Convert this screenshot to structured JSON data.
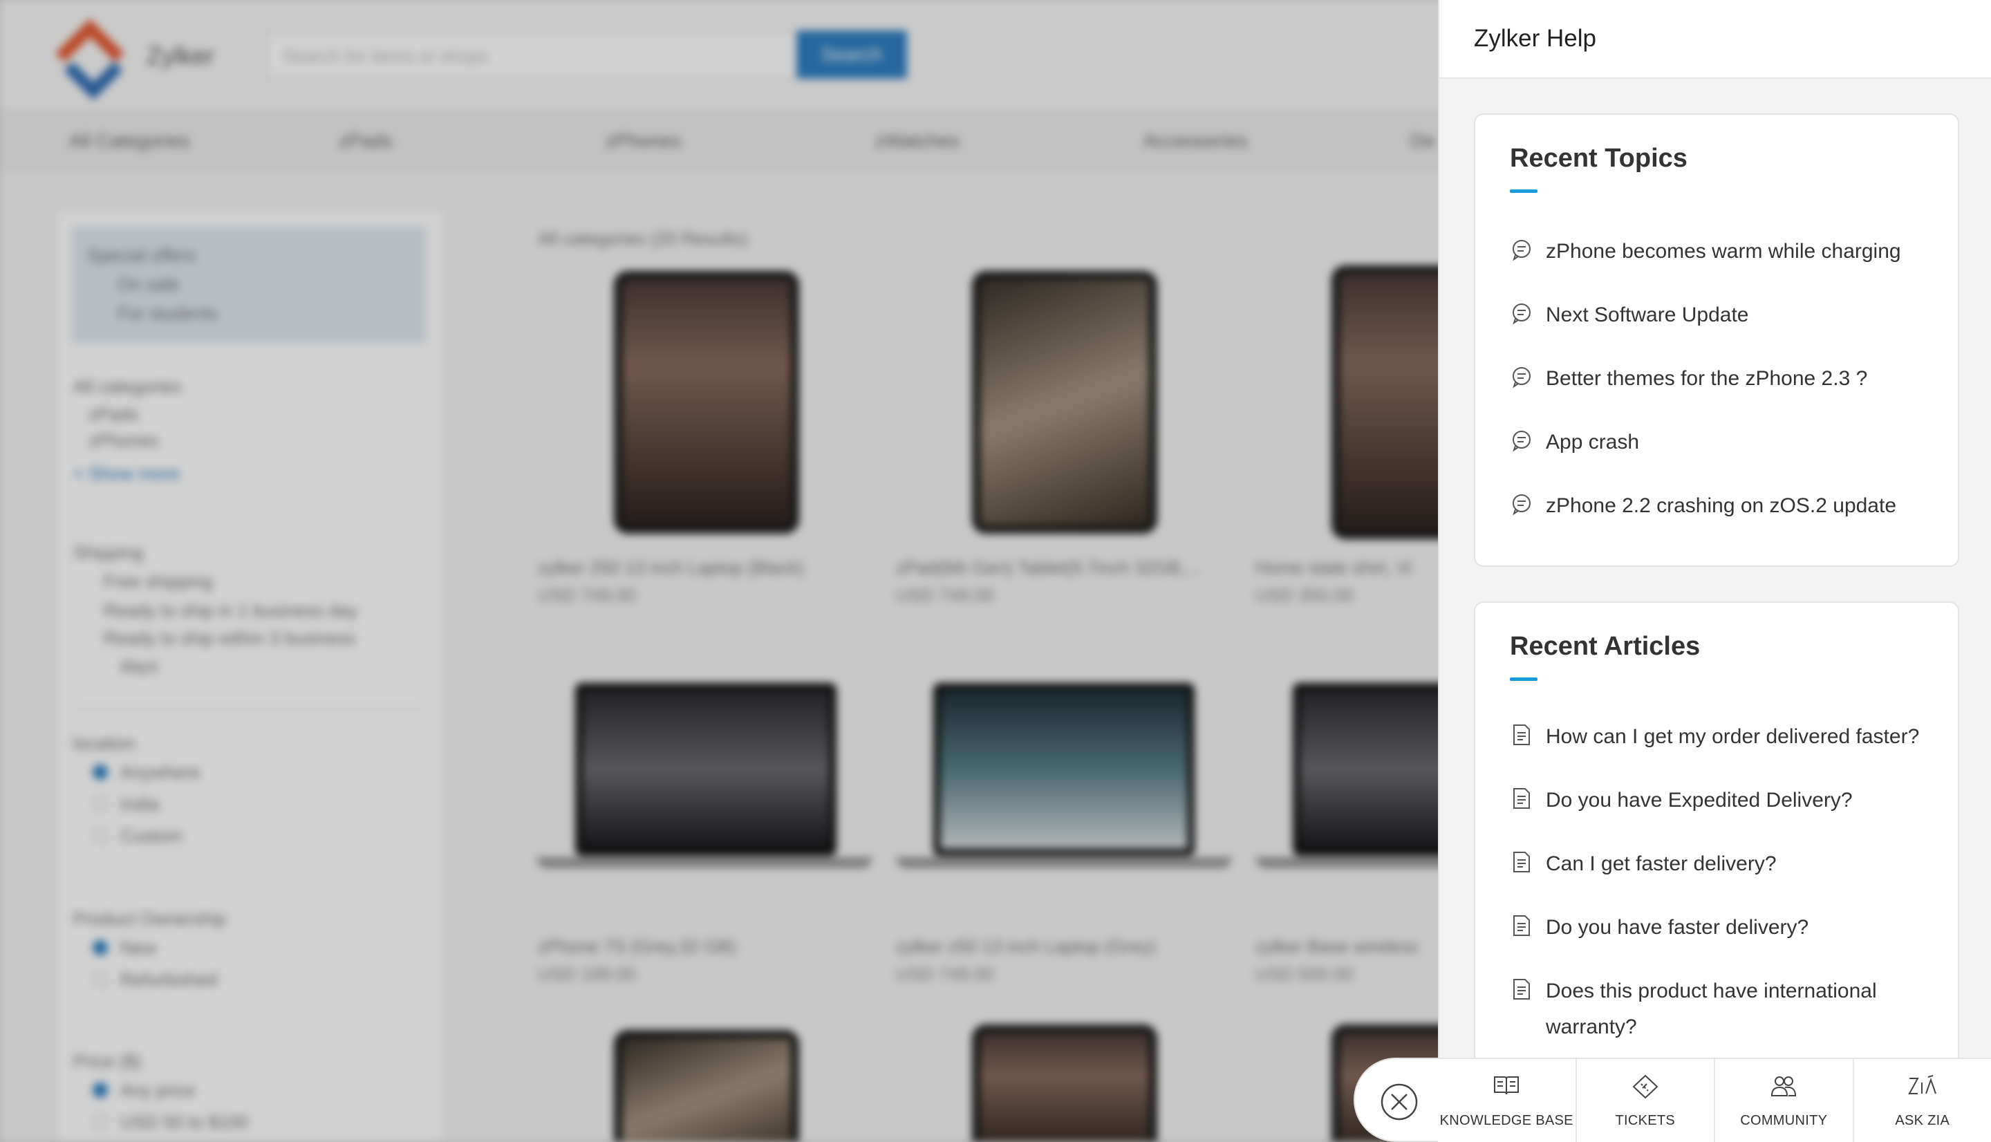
{
  "background": {
    "brand": "Zylker",
    "search_placeholder": "Search for items or shops",
    "search_button": "Search",
    "nav": [
      "All Categories",
      "zPads",
      "zPhones",
      "zWatches",
      "Accessories",
      "De"
    ],
    "filters": {
      "special_offers": "Special offers",
      "on_sale": "On sale",
      "for_students": "For students",
      "all_categories": "All categories",
      "cat1": "zPads",
      "cat2": "zPhones",
      "show_more": "+ Show more",
      "shipping": "Shipping",
      "free_shipping": "Free shipping",
      "ship1": "Ready to ship in 1 business day",
      "ship3": "Ready to ship within 3 business",
      "ship3b": "days",
      "location": "location",
      "anywhere": "Anywhere",
      "india": "India",
      "custom": "Custom",
      "ownership": "Product Ownership",
      "new": "New",
      "refurbished": "Refurbished",
      "price": "Price ($)",
      "any_price": "Any price",
      "price_range": "USD 50 to $100"
    },
    "results_label": "All categories (20 Results)",
    "products": [
      {
        "name": "zylker 250 13 inch Laptop (Black)",
        "price": "USD 749.00"
      },
      {
        "name": "zPad(6th Gen) Tablet(9.7inch 32GB,...",
        "price": "USD 749.00"
      },
      {
        "name": "Home state shirt, Vi",
        "price": "USD 350.00"
      },
      {
        "name": "zPhone 7S (Grey,32 GB)",
        "price": "USD 199.00"
      },
      {
        "name": "zylker z50 13 inch Laptop (Grey)",
        "price": "USD 749.00"
      },
      {
        "name": "zylker Base wireless",
        "price": "USD 500.00"
      }
    ]
  },
  "help": {
    "title": "Zylker Help",
    "recent_topics": {
      "heading": "Recent Topics",
      "items": [
        "zPhone becomes warm while charging",
        "Next Software Update",
        "Better themes for the zPhone 2.3 ?",
        "App crash",
        "zPhone 2.2 crashing on zOS.2 update"
      ]
    },
    "recent_articles": {
      "heading": "Recent Articles",
      "items": [
        "How can I get my order delivered faster?",
        "Do you have Expedited Delivery?",
        "Can I get faster delivery?",
        "Do you have faster delivery?",
        "Does this product have international",
        "warranty?"
      ]
    },
    "tabs": [
      {
        "label": "KNOWLEDGE BASE",
        "icon": "book-icon"
      },
      {
        "label": "TICKETS",
        "icon": "ticket-icon"
      },
      {
        "label": "COMMUNITY",
        "icon": "people-icon"
      },
      {
        "label": "ASK ZIA",
        "icon": "zia-icon"
      }
    ],
    "accent_color": "#1a9bdc"
  }
}
